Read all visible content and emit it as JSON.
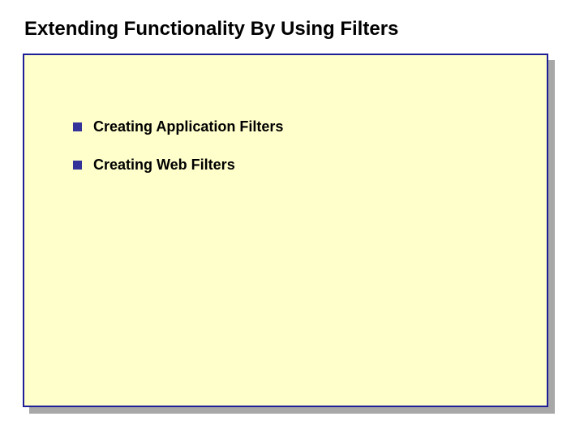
{
  "title": "Extending Functionality By Using Filters",
  "bullets": {
    "items": [
      {
        "label": "Creating Application Filters"
      },
      {
        "label": "Creating Web Filters"
      }
    ]
  }
}
